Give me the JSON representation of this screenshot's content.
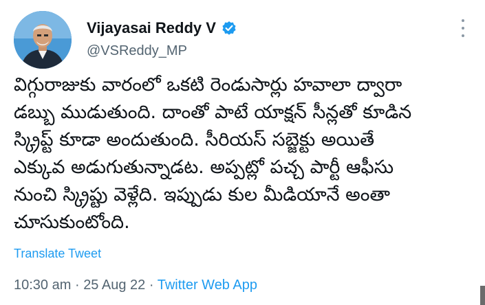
{
  "author": {
    "display_name": "Vijayasai Reddy V",
    "handle": "@VSReddy_MP",
    "verified": true
  },
  "tweet": {
    "lines": [
      "విగ్గురాజుకు వారంలో ఒకటి రెండుసార్లు హవాలా ద్వారా",
      "డబ్బు ముడుతుంది. దాంతో పాటే యాక్షన్ సీన్లతో కూడిన",
      "స్క్రిప్ట్ కూడా అందుతుంది. సీరియస్ సబ్జెక్టు అయితే",
      "ఎక్కువ అడుగుతున్నాడట. అప్పట్లో పచ్చ పార్టీ ఆఫీసు",
      "నుంచి స్క్రిప్టు వెళ్లేది. ఇప్పుడు కుల మీడియానే అంతా",
      "చూసుకుంటోంది."
    ],
    "translate_label": "Translate Tweet",
    "time": "10:30 am",
    "separator": "·",
    "date": "25 Aug 22",
    "source": "Twitter Web App"
  },
  "icons": {
    "verified": "verified-badge-icon",
    "more": "more-options-icon"
  },
  "colors": {
    "accent": "#1d9bf0",
    "text": "#0f1419",
    "secondary": "#536471"
  }
}
